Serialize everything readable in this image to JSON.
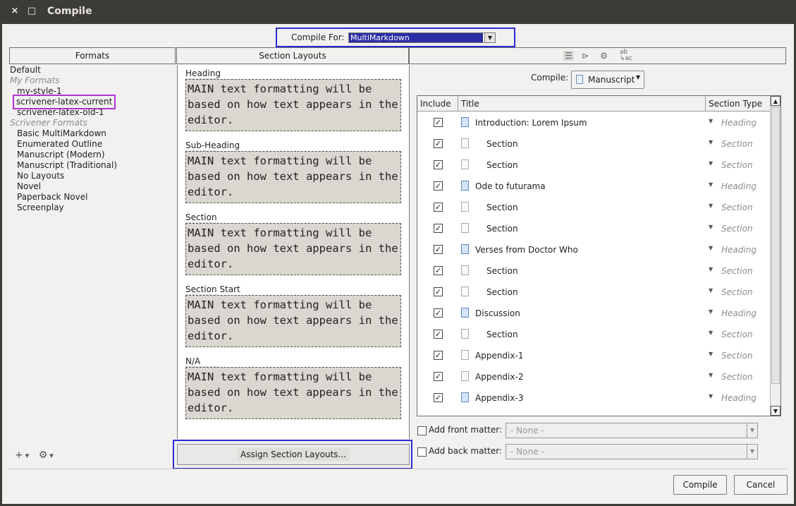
{
  "window": {
    "title": "Compile",
    "close_glyph": "×",
    "maximize_glyph": "□"
  },
  "compile_for": {
    "label": "Compile For:",
    "value": "MultiMarkdown"
  },
  "headers": {
    "formats": "Formats",
    "section_layouts": "Section Layouts"
  },
  "formats": {
    "items": [
      {
        "text": "Default",
        "kind": "item"
      },
      {
        "text": "My Formats",
        "kind": "category"
      },
      {
        "text": "my-style-1",
        "kind": "sub"
      },
      {
        "text": "scrivener-latex-current",
        "kind": "sub-highlight"
      },
      {
        "text": "scrivener-latex-old-1",
        "kind": "sub"
      },
      {
        "text": "Scrivener Formats",
        "kind": "category"
      },
      {
        "text": "Basic MultiMarkdown",
        "kind": "sub"
      },
      {
        "text": "Enumerated Outline",
        "kind": "sub"
      },
      {
        "text": "Manuscript (Modern)",
        "kind": "sub"
      },
      {
        "text": "Manuscript (Traditional)",
        "kind": "sub"
      },
      {
        "text": "No Layouts",
        "kind": "sub"
      },
      {
        "text": "Novel",
        "kind": "sub"
      },
      {
        "text": "Paperback Novel",
        "kind": "sub"
      },
      {
        "text": "Screenplay",
        "kind": "sub"
      }
    ],
    "footer": {
      "add": "+",
      "gear": "⚙",
      "arrow": "▾"
    }
  },
  "section_layouts": {
    "items": [
      {
        "name": "Heading",
        "preview": "MAIN text formatting will be based on how text appears in the editor."
      },
      {
        "name": "Sub-Heading",
        "preview": "MAIN text formatting will be based on how text appears in the editor."
      },
      {
        "name": "Section",
        "preview": "MAIN text formatting will be based on how text appears in the editor."
      },
      {
        "name": "Section Start",
        "preview": "MAIN text formatting will be based on how text appears in the editor."
      },
      {
        "name": "N/A",
        "preview": "MAIN text formatting will be based on how text appears in the editor."
      }
    ],
    "assign_button": "Assign Section Layouts..."
  },
  "right_toolbar": {
    "icons": [
      "list-icon",
      "tag-icon",
      "gear-icon",
      "replace-icon"
    ]
  },
  "compile_select": {
    "label": "Compile:",
    "value": "Manuscript"
  },
  "table": {
    "columns": [
      "Include",
      "Title",
      "Section Type"
    ],
    "rows": [
      {
        "title": "Introduction: Lorem Ipsum",
        "type": "Heading",
        "folder": true,
        "indent": 0
      },
      {
        "title": "Section",
        "type": "Section",
        "folder": false,
        "indent": 1
      },
      {
        "title": "Section",
        "type": "Section",
        "folder": false,
        "indent": 1
      },
      {
        "title": "Ode to futurama",
        "type": "Heading",
        "folder": true,
        "indent": 0
      },
      {
        "title": "Section",
        "type": "Section",
        "folder": false,
        "indent": 1
      },
      {
        "title": "Section",
        "type": "Section",
        "folder": false,
        "indent": 1
      },
      {
        "title": "Verses from Doctor Who",
        "type": "Heading",
        "folder": true,
        "indent": 0
      },
      {
        "title": "Section",
        "type": "Section",
        "folder": false,
        "indent": 1
      },
      {
        "title": "Section",
        "type": "Section",
        "folder": false,
        "indent": 1
      },
      {
        "title": "Discussion",
        "type": "Heading",
        "folder": true,
        "indent": 0
      },
      {
        "title": "Section",
        "type": "Section",
        "folder": false,
        "indent": 1
      },
      {
        "title": "Appendix-1",
        "type": "Section",
        "folder": false,
        "indent": 0
      },
      {
        "title": "Appendix-2",
        "type": "Section",
        "folder": false,
        "indent": 0
      },
      {
        "title": "Appendix-3",
        "type": "Heading",
        "folder": true,
        "indent": 0
      }
    ]
  },
  "front_matter": {
    "label": "Add front matter:",
    "value": "- None -"
  },
  "back_matter": {
    "label": "Add back matter:",
    "value": "- None -"
  },
  "buttons": {
    "compile": "Compile",
    "cancel": "Cancel"
  }
}
